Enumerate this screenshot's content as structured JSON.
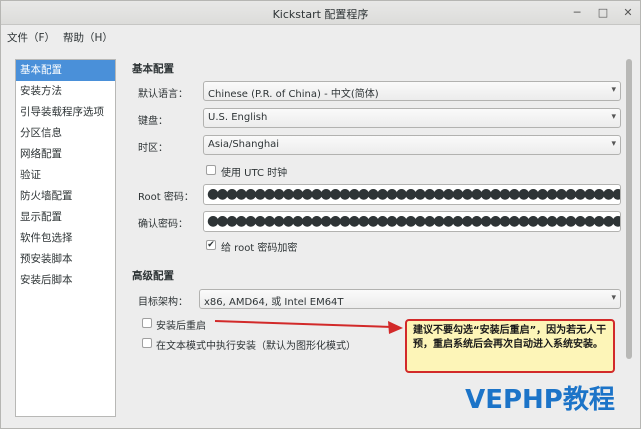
{
  "window": {
    "title": "Kickstart 配置程序"
  },
  "controls": {
    "minimize": "─",
    "maximize": "□",
    "close": "✕"
  },
  "menu": {
    "file": "文件（F）",
    "help": "帮助（H）"
  },
  "sidebar": {
    "items": [
      {
        "label": "基本配置",
        "selected": true
      },
      {
        "label": "安装方法"
      },
      {
        "label": "引导装载程序选项"
      },
      {
        "label": "分区信息"
      },
      {
        "label": "网络配置"
      },
      {
        "label": "验证"
      },
      {
        "label": "防火墙配置"
      },
      {
        "label": "显示配置"
      },
      {
        "label": "软件包选择"
      },
      {
        "label": "预安装脚本"
      },
      {
        "label": "安装后脚本"
      }
    ]
  },
  "basic": {
    "title": "基本配置",
    "language_label": "默认语言：",
    "language_value": "Chinese (P.R. of China) - 中文(简体)",
    "keyboard_label": "键盘：",
    "keyboard_value": "U.S. English",
    "timezone_label": "时区：",
    "timezone_value": "Asia/Shanghai",
    "utc_label": "使用 UTC 时钟",
    "utc_checked": false,
    "root_pwd_label": "Root 密码：",
    "confirm_pwd_label": "确认密码：",
    "pwd_mask": "●●●●●●●●●●●●●●●●●●●●●●●●●●●●●●●●●●●●●●●●●●●●",
    "encrypt_label": "给 root 密码加密",
    "encrypt_checked": true
  },
  "advanced": {
    "title": "高级配置",
    "arch_label": "目标架构：",
    "arch_value": "x86, AMD64, 或 Intel EM64T",
    "reboot_label": "安装后重启",
    "reboot_checked": false,
    "textmode_label": "在文本模式中执行安装（默认为图形化模式）",
    "textmode_checked": false
  },
  "annotation": {
    "text": "建议不要勾选“安装后重启”，因为若无人干预，重启系统后会再次自动进入系统安装。",
    "arrow_color": "#d22a2a"
  },
  "watermark": "VEPHP教程",
  "icons": {
    "dropdown": "▾",
    "check": "✔"
  }
}
